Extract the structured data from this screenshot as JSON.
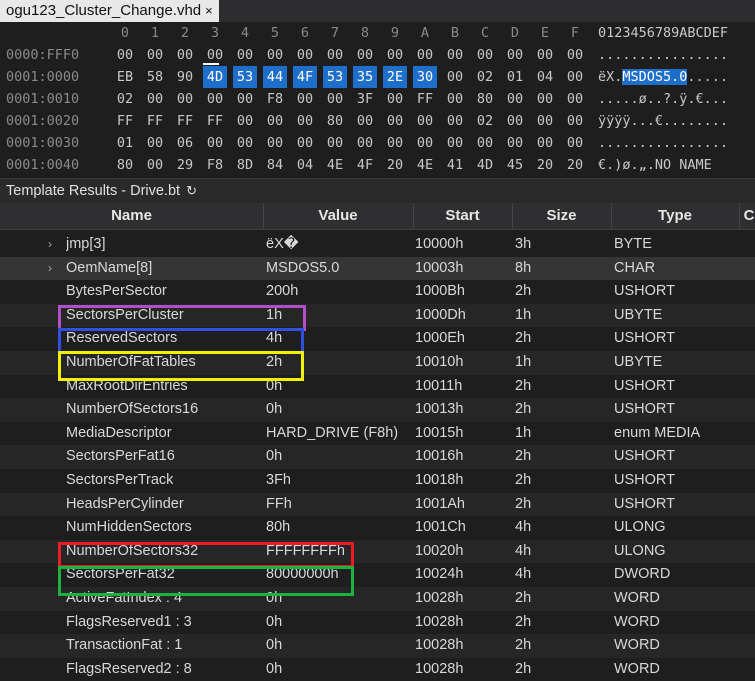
{
  "tab": {
    "title": "ogu123_Cluster_Change.vhd",
    "close": "×"
  },
  "hex": {
    "column_headers": [
      "0",
      "1",
      "2",
      "3",
      "4",
      "5",
      "6",
      "7",
      "8",
      "9",
      "A",
      "B",
      "C",
      "D",
      "E",
      "F"
    ],
    "ascii_header": "0123456789ABCDEF",
    "rows": [
      {
        "addr": "0000:FFF0",
        "bytes": [
          "00",
          "00",
          "00",
          "00",
          "00",
          "00",
          "00",
          "00",
          "00",
          "00",
          "00",
          "00",
          "00",
          "00",
          "00",
          "00"
        ],
        "ascii": "................"
      },
      {
        "addr": "0001:0000",
        "bytes": [
          "EB",
          "58",
          "90",
          "4D",
          "53",
          "44",
          "4F",
          "53",
          "35",
          "2E",
          "30",
          "00",
          "02",
          "01",
          "04",
          "00"
        ],
        "ascii": "ëX.MSDOS5.0....."
      },
      {
        "addr": "0001:0010",
        "bytes": [
          "02",
          "00",
          "00",
          "00",
          "00",
          "F8",
          "00",
          "00",
          "3F",
          "00",
          "FF",
          "00",
          "80",
          "00",
          "00",
          "00"
        ],
        "ascii": ".....ø..?.ÿ.€..."
      },
      {
        "addr": "0001:0020",
        "bytes": [
          "FF",
          "FF",
          "FF",
          "FF",
          "00",
          "00",
          "00",
          "80",
          "00",
          "00",
          "00",
          "00",
          "02",
          "00",
          "00",
          "00"
        ],
        "ascii": "ÿÿÿÿ...€........"
      },
      {
        "addr": "0001:0030",
        "bytes": [
          "01",
          "00",
          "06",
          "00",
          "00",
          "00",
          "00",
          "00",
          "00",
          "00",
          "00",
          "00",
          "00",
          "00",
          "00",
          "00"
        ],
        "ascii": "................"
      },
      {
        "addr": "0001:0040",
        "bytes": [
          "80",
          "00",
          "29",
          "F8",
          "8D",
          "84",
          "04",
          "4E",
          "4F",
          "20",
          "4E",
          "41",
          "4D",
          "45",
          "20",
          "20"
        ],
        "ascii": "€.)ø.„.NO NAME  "
      }
    ]
  },
  "template": {
    "title": "Template Results - Drive.bt",
    "refresh_icon": "↻",
    "columns": [
      "Name",
      "Value",
      "Start",
      "Size",
      "Type",
      "C"
    ],
    "rows": [
      {
        "expand": "›",
        "name": "jmp[3]",
        "value": "ëX�",
        "start": "10000h",
        "size": "3h",
        "type": "BYTE"
      },
      {
        "expand": "›",
        "name": "OemName[8]",
        "value": "MSDOS5.0",
        "start": "10003h",
        "size": "8h",
        "type": "CHAR"
      },
      {
        "name": "BytesPerSector",
        "value": "200h",
        "start": "1000Bh",
        "size": "2h",
        "type": "USHORT"
      },
      {
        "name": "SectorsPerCluster",
        "value": "1h",
        "start": "1000Dh",
        "size": "1h",
        "type": "UBYTE"
      },
      {
        "name": "ReservedSectors",
        "value": "4h",
        "start": "1000Eh",
        "size": "2h",
        "type": "USHORT"
      },
      {
        "name": "NumberOfFatTables",
        "value": "2h",
        "start": "10010h",
        "size": "1h",
        "type": "UBYTE"
      },
      {
        "name": "MaxRootDirEntries",
        "value": "0h",
        "start": "10011h",
        "size": "2h",
        "type": "USHORT"
      },
      {
        "name": "NumberOfSectors16",
        "value": "0h",
        "start": "10013h",
        "size": "2h",
        "type": "USHORT"
      },
      {
        "name": "MediaDescriptor",
        "value": "HARD_DRIVE (F8h)",
        "start": "10015h",
        "size": "1h",
        "type": "enum MEDIA"
      },
      {
        "name": "SectorsPerFat16",
        "value": "0h",
        "start": "10016h",
        "size": "2h",
        "type": "USHORT"
      },
      {
        "name": "SectorsPerTrack",
        "value": "3Fh",
        "start": "10018h",
        "size": "2h",
        "type": "USHORT"
      },
      {
        "name": "HeadsPerCylinder",
        "value": "FFh",
        "start": "1001Ah",
        "size": "2h",
        "type": "USHORT"
      },
      {
        "name": "NumHiddenSectors",
        "value": "80h",
        "start": "1001Ch",
        "size": "4h",
        "type": "ULONG"
      },
      {
        "name": "NumberOfSectors32",
        "value": "FFFFFFFFh",
        "start": "10020h",
        "size": "4h",
        "type": "ULONG"
      },
      {
        "name": "SectorsPerFat32",
        "value": "80000000h",
        "start": "10024h",
        "size": "4h",
        "type": "DWORD"
      },
      {
        "name": "ActiveFatIndex : 4",
        "value": "0h",
        "start": "10028h",
        "size": "2h",
        "type": "WORD"
      },
      {
        "name": "FlagsReserved1 : 3",
        "value": "0h",
        "start": "10028h",
        "size": "2h",
        "type": "WORD"
      },
      {
        "name": "TransactionFat : 1",
        "value": "0h",
        "start": "10028h",
        "size": "2h",
        "type": "WORD"
      },
      {
        "name": "FlagsReserved2 : 8",
        "value": "0h",
        "start": "10028h",
        "size": "2h",
        "type": "WORD"
      }
    ]
  },
  "colors": {
    "selection": "#1e6fcc",
    "highlight_purple": "#b04fc8",
    "highlight_blue": "#3050e0",
    "highlight_yellow": "#f2f200",
    "highlight_red": "#ee1c24",
    "highlight_green": "#1fb040"
  }
}
